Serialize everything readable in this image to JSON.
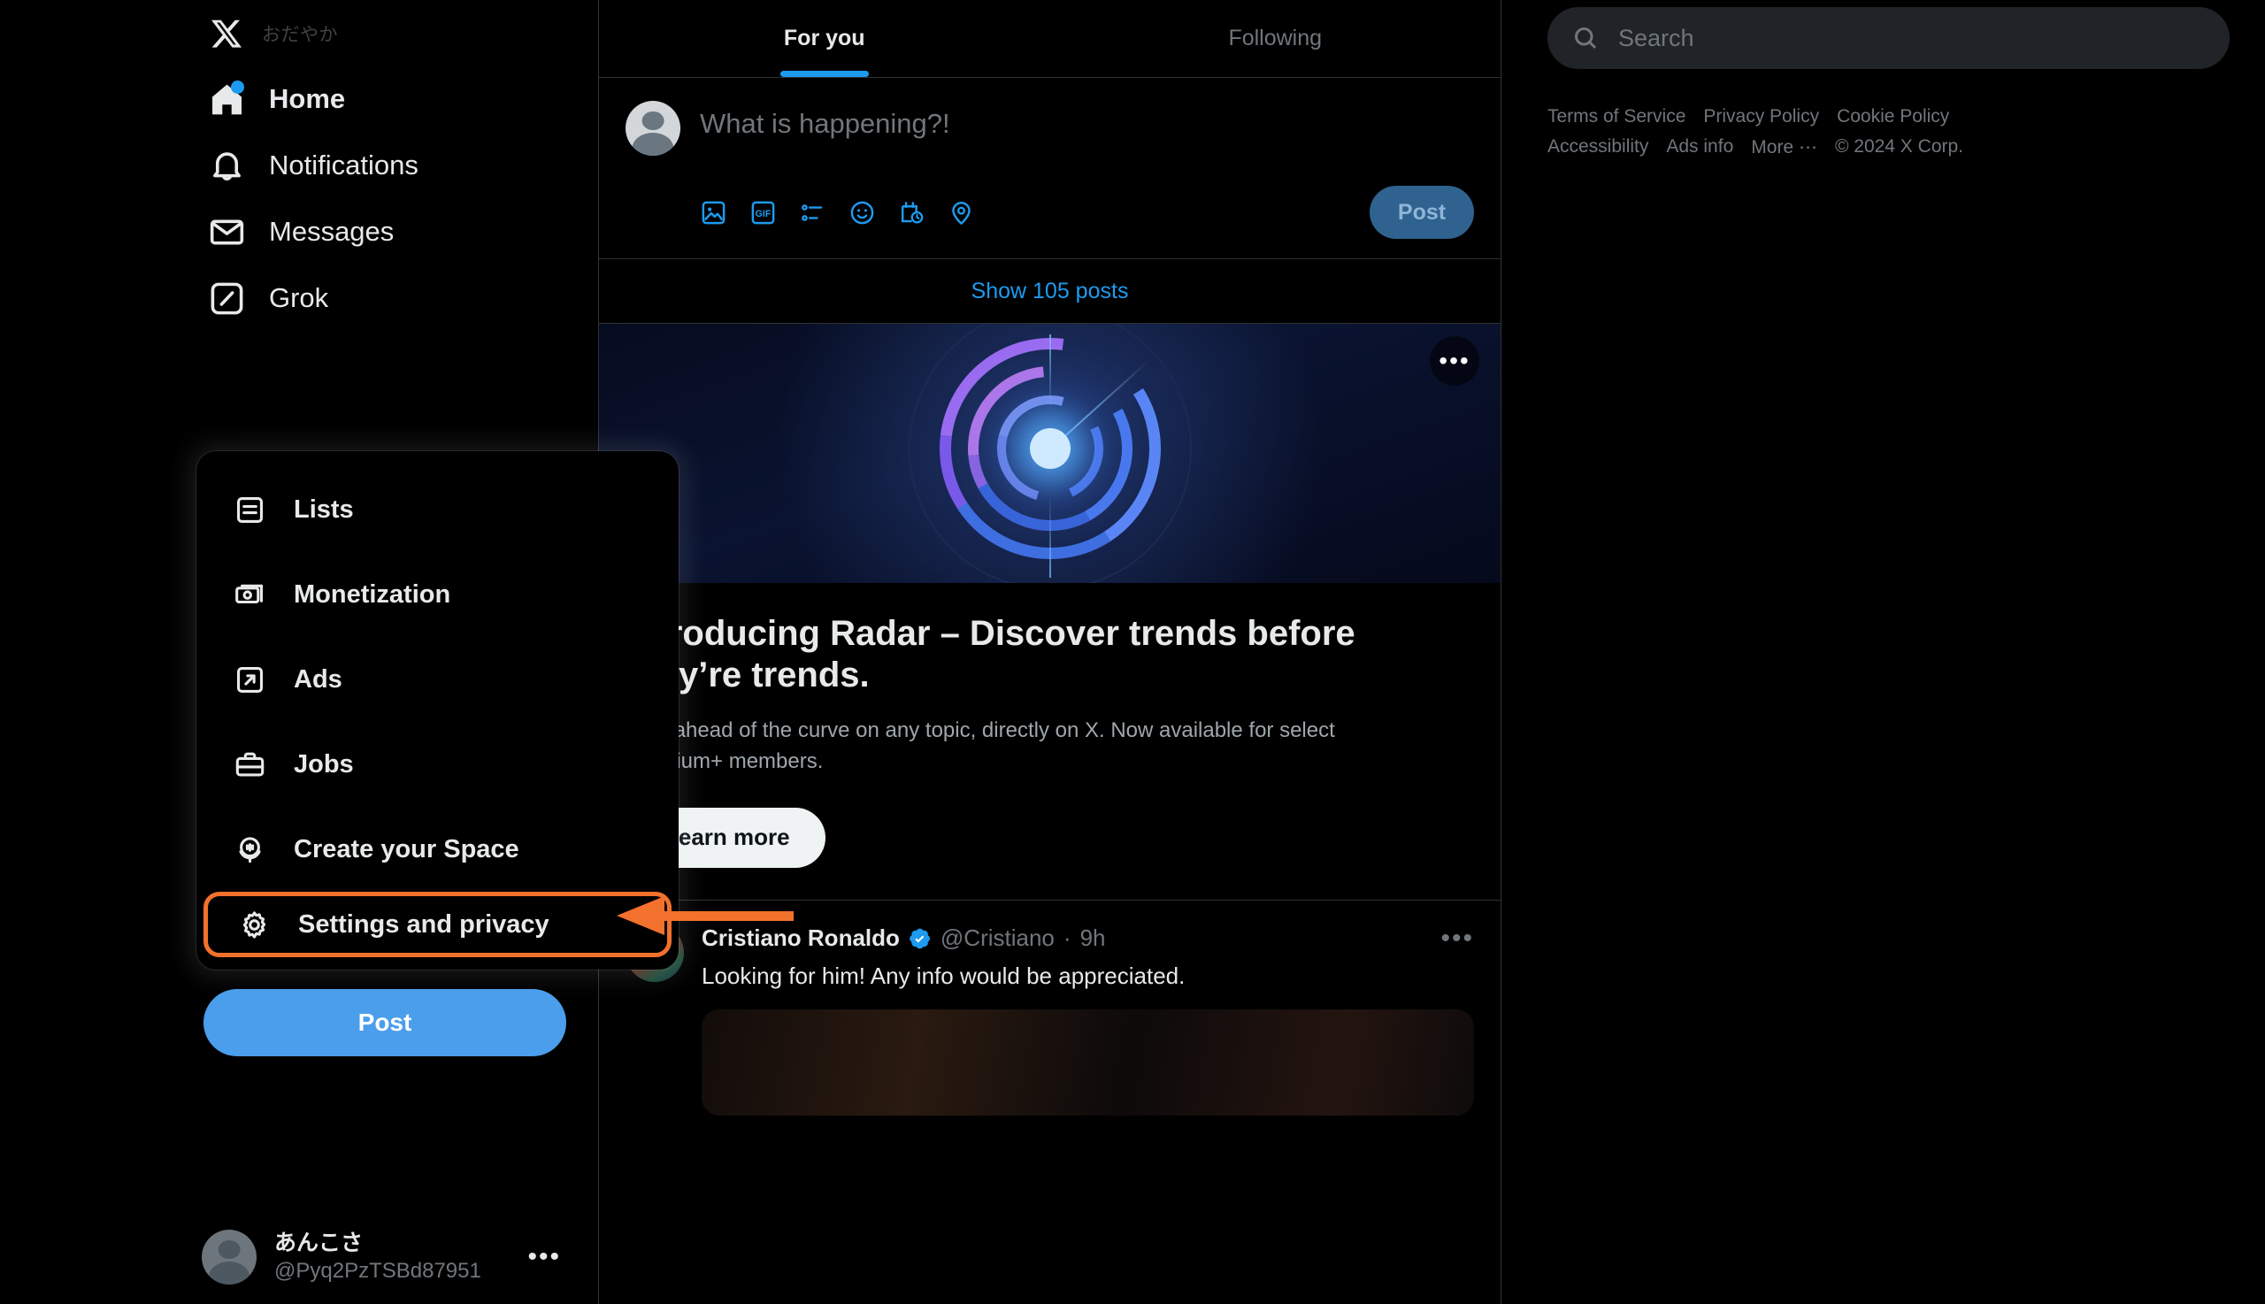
{
  "brand": {
    "logo": "x-logo",
    "status_label": "おだやか",
    "accent_blue": "#1d9bf0",
    "highlight_orange": "#f2712c"
  },
  "sidebar": {
    "items": [
      {
        "label": "Home",
        "icon": "home-icon",
        "active": true,
        "badge": true
      },
      {
        "label": "Notifications",
        "icon": "bell-icon",
        "active": false,
        "badge": false
      },
      {
        "label": "Messages",
        "icon": "envelope-icon",
        "active": false,
        "badge": false
      },
      {
        "label": "Grok",
        "icon": "grok-icon",
        "active": false,
        "badge": false
      }
    ],
    "post_button": "Post",
    "account": {
      "name": "あんこさ",
      "handle": "@Pyq2PzTSBd87951",
      "more": "•••"
    }
  },
  "menu": {
    "items": [
      {
        "label": "Lists",
        "icon": "list-icon",
        "highlighted": false
      },
      {
        "label": "Monetization",
        "icon": "money-icon",
        "highlighted": false
      },
      {
        "label": "Ads",
        "icon": "arrow-out-icon",
        "highlighted": false
      },
      {
        "label": "Jobs",
        "icon": "briefcase-icon",
        "highlighted": false
      },
      {
        "label": "Create your Space",
        "icon": "microphone-icon",
        "highlighted": false
      },
      {
        "label": "Settings and privacy",
        "icon": "gear-icon",
        "highlighted": true
      }
    ]
  },
  "feed": {
    "tabs": [
      {
        "label": "For you",
        "active": true
      },
      {
        "label": "Following",
        "active": false
      }
    ],
    "compose": {
      "placeholder": "What is happening?!",
      "post_label": "Post",
      "tools": [
        "image-icon",
        "gif-icon",
        "poll-icon",
        "emoji-icon",
        "schedule-icon",
        "location-icon"
      ]
    },
    "show_posts": "Show 105 posts",
    "ad": {
      "title": "Introducing Radar – Discover trends before they’re trends.",
      "subtitle": "Stay ahead of the curve on any topic, directly on X. Now available for select Premium+ members.",
      "cta": "Learn more",
      "more": "•••"
    },
    "tweet": {
      "name": "Cristiano Ronaldo",
      "handle": "@Cristiano",
      "time": "9h",
      "separator": "·",
      "text": "Looking for him! Any info would be appreciated.",
      "more": "•••"
    }
  },
  "search": {
    "placeholder": "Search",
    "icon": "search-icon"
  },
  "footer": {
    "links": [
      "Terms of Service",
      "Privacy Policy",
      "Cookie Policy",
      "Accessibility",
      "Ads info",
      "More ⋯"
    ],
    "copyright": "© 2024 X Corp."
  }
}
